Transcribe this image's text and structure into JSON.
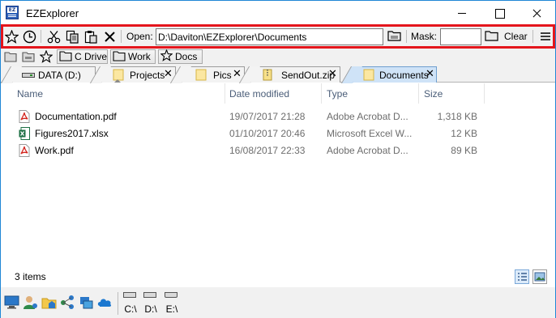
{
  "window": {
    "title": "EZExplorer",
    "app_icon_text": "EZ"
  },
  "toolbar": {
    "open_label": "Open:",
    "path_value": "D:\\Daviton\\EZExplorer\\Documents",
    "mask_label": "Mask:",
    "mask_value": "",
    "clear_label": "Clear",
    "icons": [
      "star-icon",
      "clock-icon",
      "scissors-icon",
      "copy-icon",
      "paste-icon",
      "close-icon",
      "folder-icon",
      "folder-icon",
      "menu-icon"
    ]
  },
  "favorites": {
    "items": [
      {
        "label": "C Drive",
        "icon": "folder-icon"
      },
      {
        "label": "Work",
        "icon": "folder-icon"
      },
      {
        "label": "Docs",
        "icon": "star-icon"
      }
    ]
  },
  "tabs": [
    {
      "label": "DATA (D:)",
      "icon": "drive-icon",
      "active": false
    },
    {
      "label": "Projects",
      "icon": "folder-icon",
      "active": false
    },
    {
      "label": "Pics",
      "icon": "folder-icon",
      "active": false
    },
    {
      "label": "SendOut.zip",
      "icon": "zip-icon",
      "active": false
    },
    {
      "label": "Documents",
      "icon": "folder-icon",
      "active": true
    }
  ],
  "columns": {
    "name": "Name",
    "date": "Date modified",
    "type": "Type",
    "size": "Size"
  },
  "files": [
    {
      "name": "Documentation.pdf",
      "date": "19/07/2017 21:28",
      "type": "Adobe Acrobat D...",
      "size": "1,318 KB",
      "icon": "pdf-icon"
    },
    {
      "name": "Figures2017.xlsx",
      "date": "01/10/2017 20:46",
      "type": "Microsoft Excel W...",
      "size": "12 KB",
      "icon": "excel-icon"
    },
    {
      "name": "Work.pdf",
      "date": "16/08/2017 22:33",
      "type": "Adobe Acrobat D...",
      "size": "89 KB",
      "icon": "pdf-icon"
    }
  ],
  "status": {
    "item_count": "3 items"
  },
  "drives": [
    {
      "label": "C:\\"
    },
    {
      "label": "D:\\"
    },
    {
      "label": "E:\\"
    }
  ],
  "colors": {
    "highlight": "#e4151c",
    "active_tab": "#cfe3f7",
    "header_text": "#4a5d78"
  }
}
